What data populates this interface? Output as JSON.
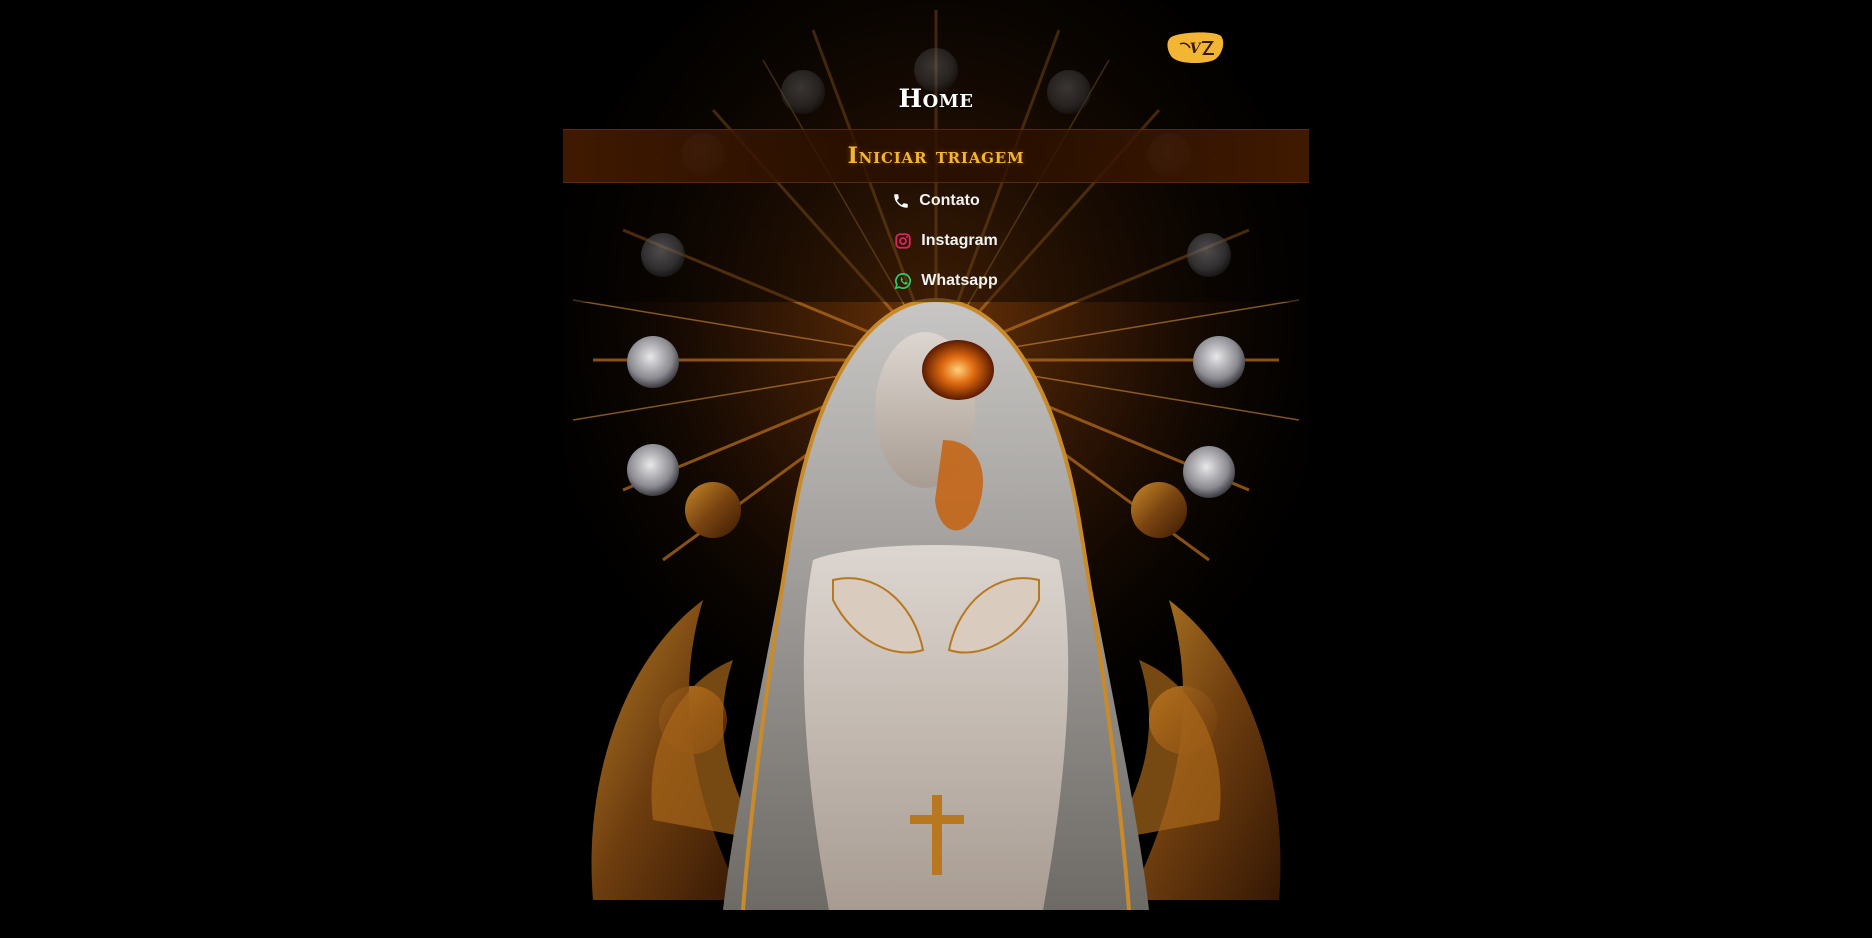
{
  "logo": {
    "text": "Varz",
    "color": "#f2b534"
  },
  "nav": {
    "home_label": "Home",
    "triage_label": "Iniciar triagem",
    "links": [
      {
        "label": "Contato",
        "icon": "phone-icon",
        "icon_color": "#ffffff"
      },
      {
        "label": "Instagram",
        "icon": "instagram-icon",
        "icon_color": "#e0245e"
      },
      {
        "label": "Whatsapp",
        "icon": "whatsapp-icon",
        "icon_color": "#25d366"
      }
    ]
  },
  "colors": {
    "background": "#000000",
    "accent": "#f2b534",
    "triage_bar": "#3a1500"
  }
}
